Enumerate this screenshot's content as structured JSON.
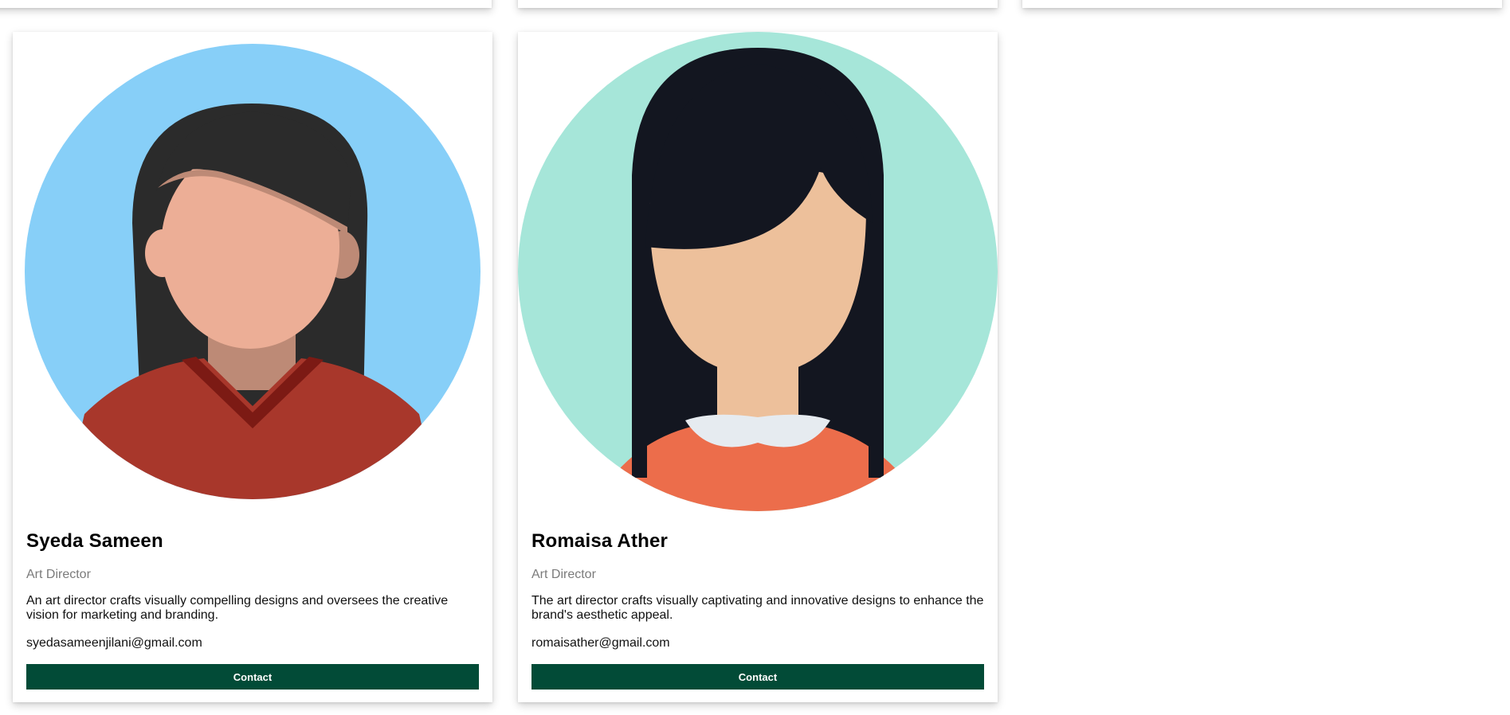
{
  "cards": [
    {
      "name": "Syeda Sameen",
      "role": "Art Director",
      "description": "An art director crafts visually compelling designs and oversees the creative vision for marketing and branding.",
      "email": "syedasameenjilani@gmail.com",
      "button_label": "Contact",
      "avatar_icon": "woman-avatar-icon",
      "colors": {
        "background": "#87cff8",
        "hair": "#2b2b2b",
        "skin": "#ecae96",
        "shirt": "#a8372b"
      }
    },
    {
      "name": "Romaisa Ather",
      "role": "Art Director",
      "description": "The art director crafts visually captivating and innovative designs to enhance the brand's aesthetic appeal.",
      "email": "romaisather@gmail.com",
      "button_label": "Contact",
      "avatar_icon": "woman-avatar-icon",
      "colors": {
        "background": "#a6e6d9",
        "hair": "#131620",
        "skin": "#edc09b",
        "shirt": "#ec6d4b"
      }
    }
  ],
  "theme": {
    "button_color": "#024b37",
    "role_color": "#7b7b7b"
  }
}
